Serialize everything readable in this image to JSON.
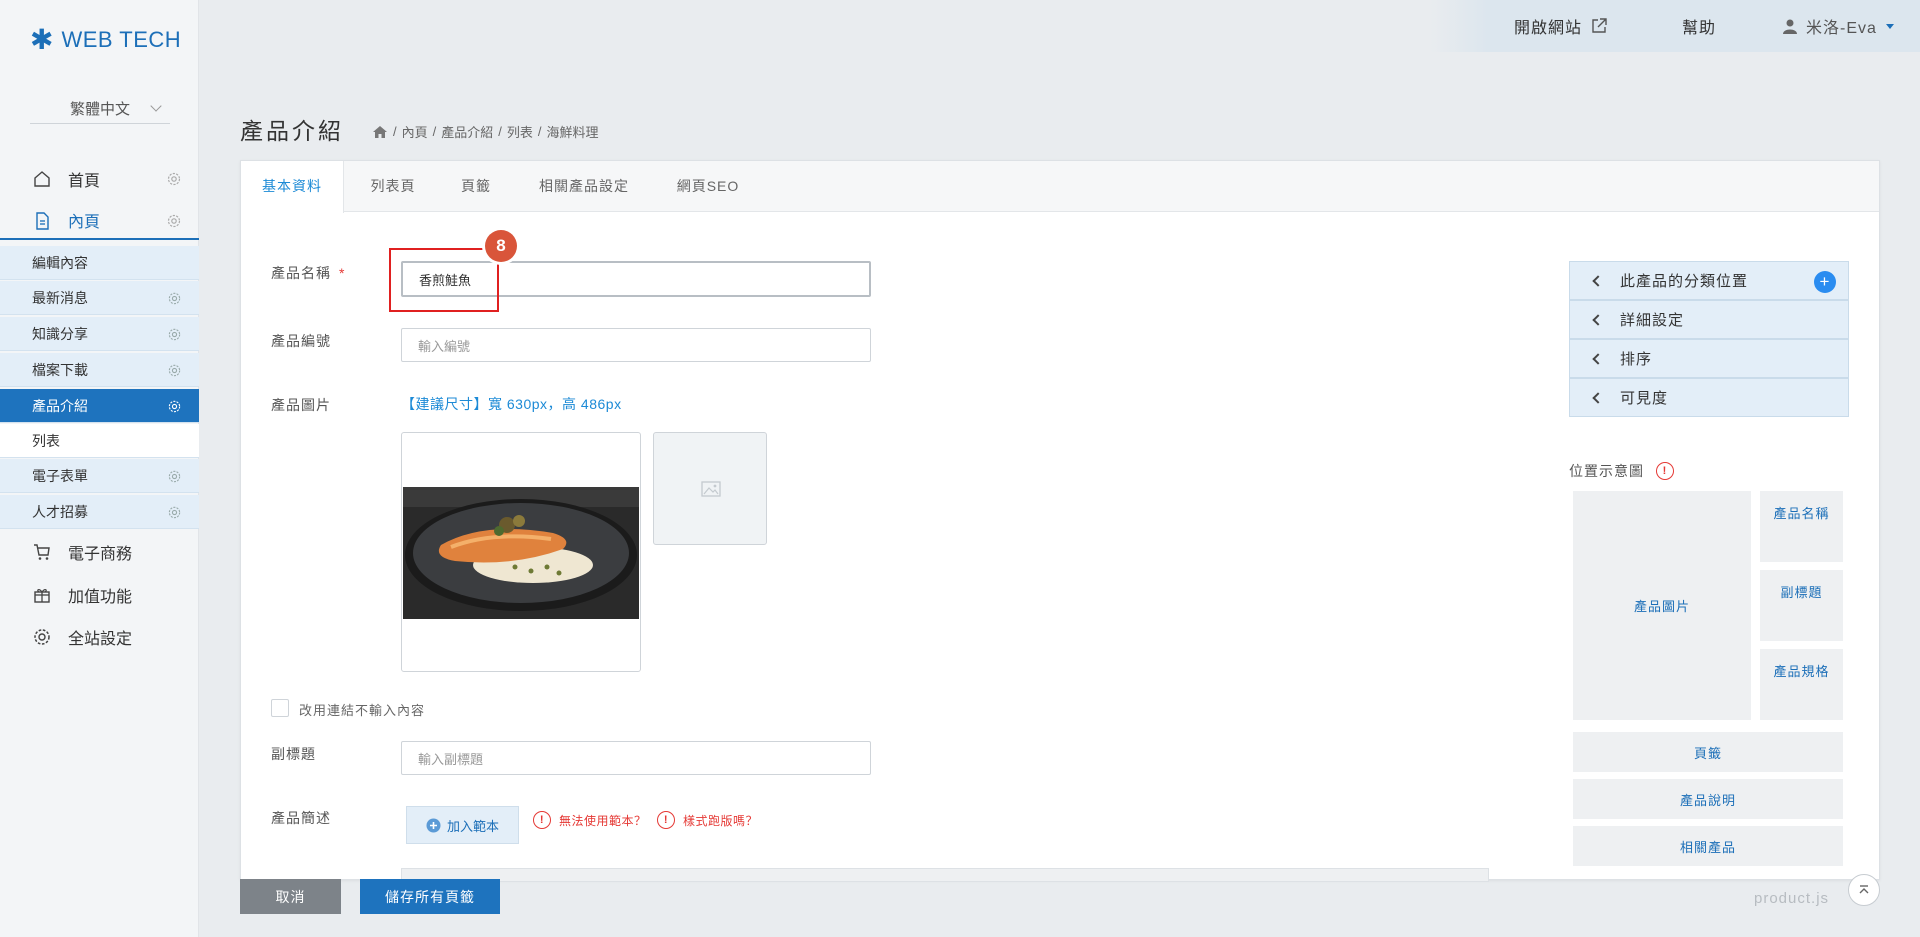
{
  "brand": {
    "logo_text": "WEB TECH",
    "accent": "#1c6fb8"
  },
  "sidebar": {
    "language": "繁體中文",
    "top_items": [
      {
        "label": "首頁",
        "icon": "home-icon"
      },
      {
        "label": "內頁",
        "icon": "document-icon"
      }
    ],
    "sub_items": [
      {
        "label": "編輯內容"
      },
      {
        "label": "最新消息"
      },
      {
        "label": "知識分享"
      },
      {
        "label": "檔案下載"
      },
      {
        "label": "產品介紹"
      },
      {
        "label": "列表"
      },
      {
        "label": "電子表單"
      },
      {
        "label": "人才招募"
      }
    ],
    "bottom_items": [
      {
        "label": "電子商務",
        "icon": "cart-icon"
      },
      {
        "label": "加值功能",
        "icon": "gift-icon"
      },
      {
        "label": "全站設定",
        "icon": "gear-icon"
      }
    ]
  },
  "topbar": {
    "open_site": "開啟網站",
    "help": "幫助",
    "user": "米洛-Eva"
  },
  "page": {
    "title": "產品介紹",
    "breadcrumb": [
      "內頁",
      "產品介紹",
      "列表",
      "海鮮料理"
    ]
  },
  "tabs": [
    "基本資料",
    "列表頁",
    "頁籤",
    "相關產品設定",
    "網頁SEO"
  ],
  "form": {
    "name_label": "產品名稱",
    "required_mark": "*",
    "name_value": "香煎鮭魚",
    "number_label": "產品編號",
    "number_placeholder": "輸入編號",
    "image_label": "產品圖片",
    "image_hint": "【建議尺寸】寬 630px，高 486px",
    "link_checkbox_label": "改用連結不輸入內容",
    "subtitle_label": "副標題",
    "subtitle_placeholder": "輸入副標題",
    "summary_label": "產品簡述",
    "add_template": "加入範本",
    "warn_template": "無法使用範本？",
    "warn_layout": "樣式跑版嗎？"
  },
  "annotation": {
    "step": "8"
  },
  "right_panel": {
    "accordion": [
      "此產品的分類位置",
      "詳細設定",
      "排序",
      "可見度"
    ],
    "position_title": "位置示意圖",
    "blocks": {
      "image": "產品圖片",
      "name": "產品名稱",
      "subtitle": "副標題",
      "spec": "產品規格",
      "tabs": "頁籤",
      "description": "產品說明",
      "related": "相關產品"
    }
  },
  "footer": {
    "cancel": "取消",
    "save_all": "儲存所有頁籤",
    "file": "product.js"
  }
}
